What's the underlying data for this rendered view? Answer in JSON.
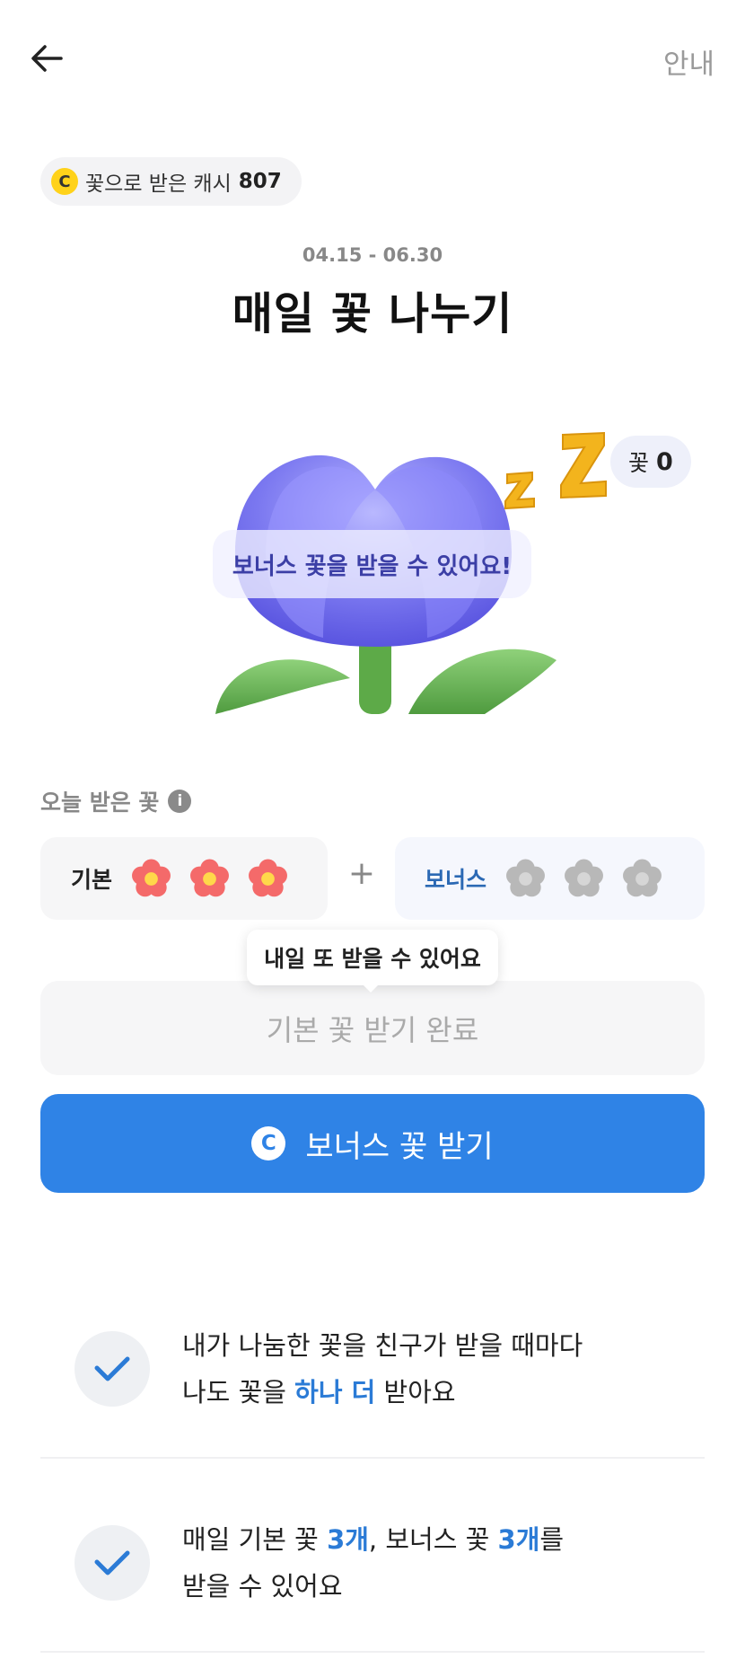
{
  "header": {
    "back_icon": "arrow-left-icon",
    "guide_label": "안내"
  },
  "cash": {
    "coin_symbol": "C",
    "label": "꽃으로 받은 캐시",
    "value": "807"
  },
  "event": {
    "period": "04.15 - 06.30",
    "title": "매일 꽃 나누기"
  },
  "illustration": {
    "bonus_message": "보너스 꽃을 받을 수 있어요!",
    "count_label": "꽃",
    "count_value": "0"
  },
  "today": {
    "label": "오늘 받은 꽃",
    "basic_label": "기본",
    "bonus_label": "보너스",
    "plus": "+",
    "basic_received": 3,
    "basic_total": 3,
    "bonus_received": 0,
    "bonus_total": 3
  },
  "tooltip": {
    "text": "내일 또 받을 수 있어요"
  },
  "buttons": {
    "done_label": "기본 꽃 받기 완료",
    "bonus_label": "보너스 꽃 받기",
    "bonus_coin": "C"
  },
  "benefits": [
    {
      "line1": "내가 나눔한 꽃을 친구가 받을 때마다",
      "line2_pre": "나도 꽃을 ",
      "line2_hl": "하나 더",
      "line2_post": " 받아요"
    },
    {
      "line1_pre": "매일 기본 꽃 ",
      "line1_hl1": "3개",
      "line1_mid": ", 보너스 꽃 ",
      "line1_hl2": "3개",
      "line1_post": "를",
      "line2": "받을 수 있어요"
    }
  ],
  "colors": {
    "primary": "#2f83e6",
    "highlight": "#2b7bd6",
    "flower_active": "#f46a6a",
    "flower_inactive": "#b8b8b8",
    "coin": "#ffd21a"
  }
}
